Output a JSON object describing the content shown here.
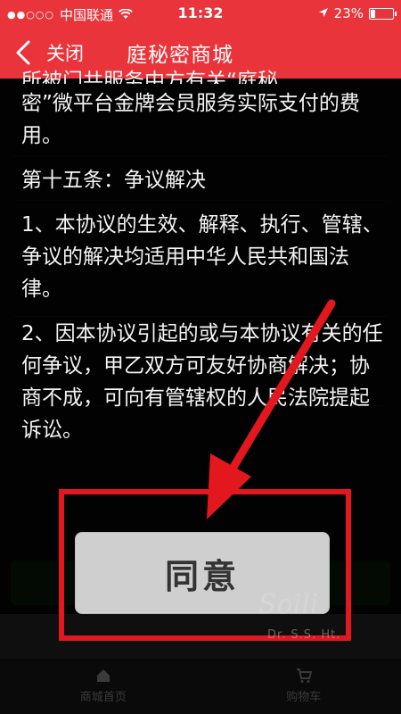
{
  "status_bar": {
    "carrier": "中国联通",
    "time": "11:32",
    "battery_percent": "23%",
    "battery_level": 0.23
  },
  "nav": {
    "back_icon": "chevron-left-icon",
    "close_label": "关闭",
    "title": "庭秘密商城"
  },
  "terms": {
    "top_fragment": "所被门共服务中方有关“庭秘",
    "paragraphs": [
      "密”微平台金牌会员服务实际支付的费用。",
      "第十五条：争议解决",
      "1、本协议的生效、解释、执行、管辖、争议的解决均适用中华人民共和国法律。",
      "2、因本协议引起的或与本协议有关的任何争议，甲乙双方可友好协商解决；协商不成，可向有管辖权的人民法院提起诉讼。"
    ]
  },
  "agree_button": {
    "label": "同意"
  },
  "background": {
    "tabs": [
      "商城首页",
      "购物车"
    ]
  },
  "watermark": {
    "text": "Soili",
    "sub": "Dr. S.S. Ht."
  },
  "colors": {
    "nav_red": "#e8343a",
    "annotation_red": "#e3181e",
    "button_gray": "#cfcfcf"
  }
}
